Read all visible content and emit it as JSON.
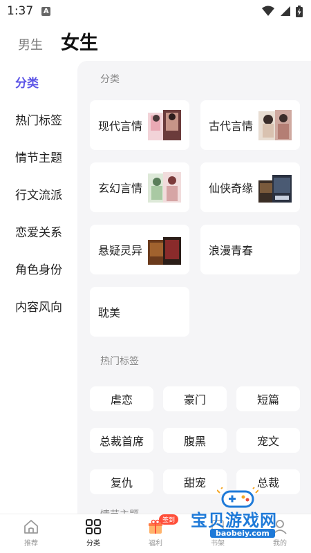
{
  "status_bar": {
    "time": "1:37",
    "notif_letter": "A"
  },
  "gender_tabs": {
    "male": "男生",
    "female": "女生"
  },
  "sidebar": {
    "items": [
      {
        "label": "分类",
        "active": true
      },
      {
        "label": "热门标签"
      },
      {
        "label": "情节主题"
      },
      {
        "label": "行文流派"
      },
      {
        "label": "恋爱关系"
      },
      {
        "label": "角色身份"
      },
      {
        "label": "内容风向"
      }
    ]
  },
  "categories_section": {
    "title": "分类",
    "items": [
      {
        "label": "现代言情",
        "cover": "book-cover"
      },
      {
        "label": "古代言情",
        "cover": "book-cover"
      },
      {
        "label": "玄幻言情",
        "cover": "book-cover"
      },
      {
        "label": "仙侠奇缘",
        "cover": "book-cover"
      },
      {
        "label": "悬疑灵异",
        "cover": "book-cover"
      },
      {
        "label": "浪漫青春"
      },
      {
        "label": "耽美"
      }
    ]
  },
  "hot_tags_section": {
    "title": "热门标签",
    "tags": [
      "虐恋",
      "豪门",
      "短篇",
      "总裁首席",
      "腹黑",
      "宠文",
      "复仇",
      "甜宠",
      "总裁"
    ]
  },
  "next_section_partial": "情节主题",
  "bottom_nav": {
    "items": [
      {
        "label": "推荐",
        "icon": "home-icon"
      },
      {
        "label": "分类",
        "icon": "grid-icon",
        "active": true
      },
      {
        "label": "福利",
        "icon": "gift-icon",
        "badge": "签到"
      },
      {
        "label": "书架",
        "icon": "bookshelf-icon"
      },
      {
        "label": "我的",
        "icon": "profile-icon"
      }
    ]
  },
  "watermark": {
    "text": "宝贝游戏网",
    "url": "baobeiy.com"
  },
  "colors": {
    "accent": "#5b53e6",
    "badge": "#ff4f3a",
    "content_bg": "#f5f5f7",
    "watermark": "#1f7ad8"
  }
}
